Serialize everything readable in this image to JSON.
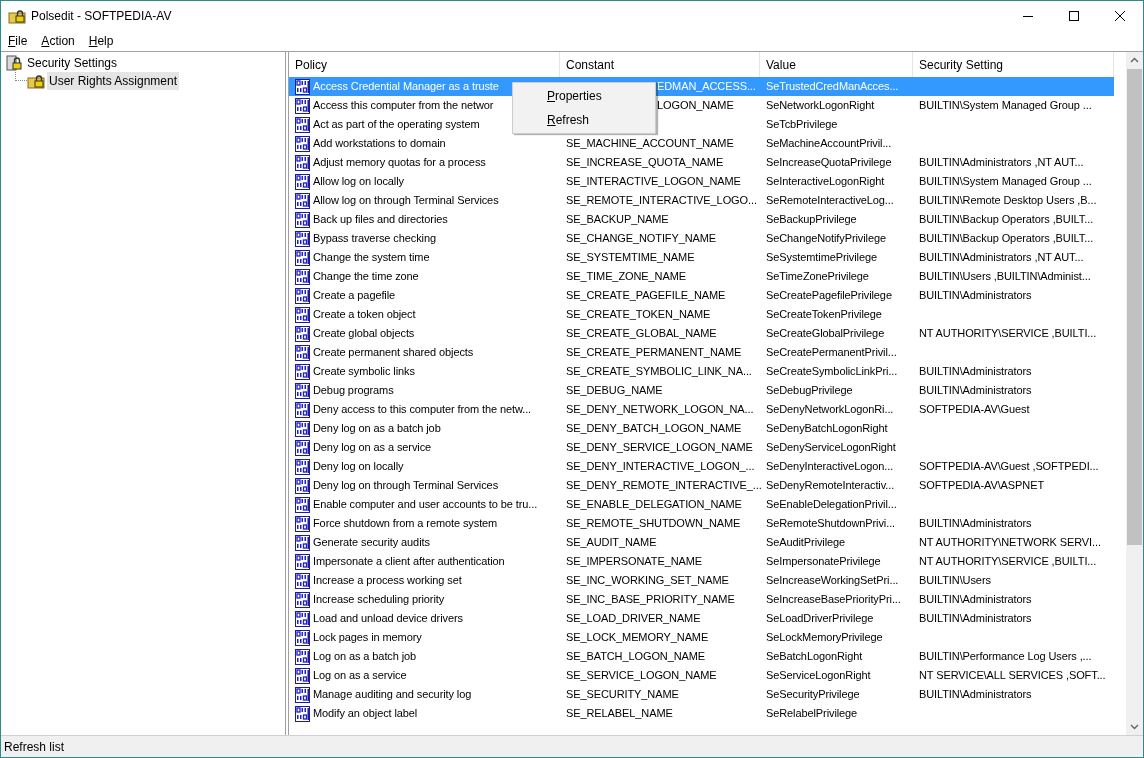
{
  "window": {
    "title": "Polsedit - SOFTPEDIA-AV"
  },
  "menu": [
    {
      "label": "File"
    },
    {
      "label": "Action"
    },
    {
      "label": "Help"
    }
  ],
  "tree": {
    "label": "Security Settings",
    "children": [
      {
        "label": "User Rights Assignment",
        "selected": true
      }
    ]
  },
  "table": {
    "columns": [
      "Policy",
      "Constant",
      "Value",
      "Security Setting"
    ],
    "rows": [
      {
        "policy": "Access Credential Manager as a truste",
        "constant": "EDMAN_ACCESS...",
        "constant_clipped": true,
        "value": "SeTrustedCredManAcces...",
        "selected": true
      },
      {
        "policy": "Access this computer from the networ",
        "constant": "LOGON_NAME",
        "constant_clipped": true,
        "value": "SeNetworkLogonRight",
        "setting": "BUILTIN\\System Managed Group ...",
        "selected": false
      },
      {
        "policy": "Act as part of the operating system",
        "value": "SeTcbPrivilege",
        "selected": false
      },
      {
        "policy": "Add workstations to domain",
        "constant": "SE_MACHINE_ACCOUNT_NAME",
        "value": "SeMachineAccountPrivil...",
        "selected": false
      },
      {
        "policy": "Adjust memory quotas for a process",
        "constant": "SE_INCREASE_QUOTA_NAME",
        "value": "SeIncreaseQuotaPrivilege",
        "setting": "BUILTIN\\Administrators ,NT AUT...",
        "selected": false
      },
      {
        "policy": "Allow log on locally",
        "constant": "SE_INTERACTIVE_LOGON_NAME",
        "value": "SeInteractiveLogonRight",
        "setting": "BUILTIN\\System Managed Group ...",
        "selected": false
      },
      {
        "policy": "Allow log on through Terminal Services",
        "constant": "SE_REMOTE_INTERACTIVE_LOGO...",
        "value": "SeRemoteInteractiveLog...",
        "setting": "BUILTIN\\Remote Desktop Users ,B...",
        "selected": false
      },
      {
        "policy": "Back up files and directories",
        "constant": "SE_BACKUP_NAME",
        "value": "SeBackupPrivilege",
        "setting": "BUILTIN\\Backup Operators ,BUILT...",
        "selected": false
      },
      {
        "policy": "Bypass traverse checking",
        "constant": "SE_CHANGE_NOTIFY_NAME",
        "value": "SeChangeNotifyPrivilege",
        "setting": "BUILTIN\\Backup Operators ,BUILT...",
        "selected": false
      },
      {
        "policy": "Change the system time",
        "constant": "SE_SYSTEMTIME_NAME",
        "value": "SeSystemtimePrivilege",
        "setting": "BUILTIN\\Administrators ,NT AUT...",
        "selected": false
      },
      {
        "policy": "Change the time zone",
        "constant": "SE_TIME_ZONE_NAME",
        "value": "SeTimeZonePrivilege",
        "setting": "BUILTIN\\Users ,BUILTIN\\Administ...",
        "selected": false
      },
      {
        "policy": "Create a pagefile",
        "constant": "SE_CREATE_PAGEFILE_NAME",
        "value": "SeCreatePagefilePrivilege",
        "setting": "BUILTIN\\Administrators",
        "selected": false
      },
      {
        "policy": "Create a token object",
        "constant": "SE_CREATE_TOKEN_NAME",
        "value": "SeCreateTokenPrivilege",
        "selected": false
      },
      {
        "policy": "Create global objects",
        "constant": "SE_CREATE_GLOBAL_NAME",
        "value": "SeCreateGlobalPrivilege",
        "setting": "NT AUTHORITY\\SERVICE ,BUILTI...",
        "selected": false
      },
      {
        "policy": "Create permanent shared objects",
        "constant": "SE_CREATE_PERMANENT_NAME",
        "value": "SeCreatePermanentPrivil...",
        "selected": false
      },
      {
        "policy": "Create symbolic links",
        "constant": "SE_CREATE_SYMBOLIC_LINK_NA...",
        "value": "SeCreateSymbolicLinkPri...",
        "setting": "BUILTIN\\Administrators",
        "selected": false
      },
      {
        "policy": "Debug programs",
        "constant": "SE_DEBUG_NAME",
        "value": "SeDebugPrivilege",
        "setting": "BUILTIN\\Administrators",
        "selected": false
      },
      {
        "policy": "Deny access to this computer from the netw...",
        "constant": "SE_DENY_NETWORK_LOGON_NA...",
        "value": "SeDenyNetworkLogonRi...",
        "setting": "SOFTPEDIA-AV\\Guest",
        "selected": false
      },
      {
        "policy": "Deny log on as a batch job",
        "constant": "SE_DENY_BATCH_LOGON_NAME",
        "value": "SeDenyBatchLogonRight",
        "selected": false
      },
      {
        "policy": "Deny log on as a service",
        "constant": "SE_DENY_SERVICE_LOGON_NAME",
        "value": "SeDenyServiceLogonRight",
        "selected": false
      },
      {
        "policy": "Deny log on locally",
        "constant": "SE_DENY_INTERACTIVE_LOGON_...",
        "value": "SeDenyInteractiveLogon...",
        "setting": "SOFTPEDIA-AV\\Guest ,SOFTPEDI...",
        "selected": false
      },
      {
        "policy": "Deny log on through Terminal Services",
        "constant": "SE_DENY_REMOTE_INTERACTIVE_...",
        "value": "SeDenyRemoteInteractiv...",
        "setting": "SOFTPEDIA-AV\\ASPNET",
        "selected": false
      },
      {
        "policy": "Enable computer and user accounts to be tru...",
        "constant": "SE_ENABLE_DELEGATION_NAME",
        "value": "SeEnableDelegationPrivil...",
        "selected": false
      },
      {
        "policy": "Force shutdown from a remote system",
        "constant": "SE_REMOTE_SHUTDOWN_NAME",
        "value": "SeRemoteShutdownPrivi...",
        "setting": "BUILTIN\\Administrators",
        "selected": false
      },
      {
        "policy": "Generate security audits",
        "constant": "SE_AUDIT_NAME",
        "value": "SeAuditPrivilege",
        "setting": "NT AUTHORITY\\NETWORK SERVI...",
        "selected": false
      },
      {
        "policy": "Impersonate a client after authentication",
        "constant": "SE_IMPERSONATE_NAME",
        "value": "SeImpersonatePrivilege",
        "setting": "NT AUTHORITY\\SERVICE ,BUILTI...",
        "selected": false
      },
      {
        "policy": "Increase a process working set",
        "constant": "SE_INC_WORKING_SET_NAME",
        "value": "SeIncreaseWorkingSetPri...",
        "setting": "BUILTIN\\Users",
        "selected": false
      },
      {
        "policy": "Increase scheduling priority",
        "constant": "SE_INC_BASE_PRIORITY_NAME",
        "value": "SeIncreaseBasePriorityPri...",
        "setting": "BUILTIN\\Administrators",
        "selected": false
      },
      {
        "policy": "Load and unload device drivers",
        "constant": "SE_LOAD_DRIVER_NAME",
        "value": "SeLoadDriverPrivilege",
        "setting": "BUILTIN\\Administrators",
        "selected": false
      },
      {
        "policy": "Lock pages in memory",
        "constant": "SE_LOCK_MEMORY_NAME",
        "value": "SeLockMemoryPrivilege",
        "selected": false
      },
      {
        "policy": "Log on as a batch job",
        "constant": "SE_BATCH_LOGON_NAME",
        "value": "SeBatchLogonRight",
        "setting": "BUILTIN\\Performance Log Users ,...",
        "selected": false
      },
      {
        "policy": "Log on as a service",
        "constant": "SE_SERVICE_LOGON_NAME",
        "value": "SeServiceLogonRight",
        "setting": "NT SERVICE\\ALL SERVICES ,SOFT...",
        "selected": false
      },
      {
        "policy": "Manage auditing and security log",
        "constant": "SE_SECURITY_NAME",
        "value": "SeSecurityPrivilege",
        "setting": "BUILTIN\\Administrators",
        "selected": false
      },
      {
        "policy": "Modify an object label",
        "constant": "SE_RELABEL_NAME",
        "value": "SeRelabelPrivilege",
        "selected": false
      }
    ]
  },
  "context_menu": [
    {
      "label": "Properties"
    },
    {
      "label": "Refresh"
    }
  ],
  "status_bar": "Refresh list"
}
